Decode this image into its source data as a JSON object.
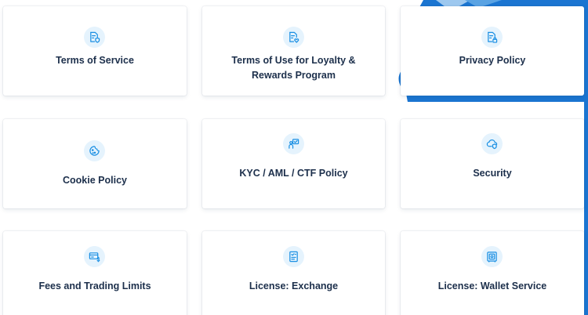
{
  "colors": {
    "accent": "#1a8fe3",
    "brand_blue": "#1b75d1",
    "icon_bg": "#e5f3fd",
    "text": "#1c2f4b"
  },
  "cards": [
    {
      "label": "Terms of Service",
      "icon": "document-shield-icon"
    },
    {
      "label": "Terms of Use for Loyalty & Rewards Program",
      "label_line1": "Terms of Use for Loyalty &",
      "label_line2": "Rewards Program",
      "icon": "document-heart-icon"
    },
    {
      "label": "Privacy Policy",
      "icon": "document-lock-icon"
    },
    {
      "label": "Cookie Policy",
      "icon": "cookie-icon"
    },
    {
      "label": "KYC / AML / CTF Policy",
      "icon": "id-verification-icon"
    },
    {
      "label": "Security",
      "icon": "cloud-shield-icon"
    },
    {
      "label": "Fees and Trading Limits",
      "icon": "card-dollar-icon"
    },
    {
      "label": "License: Exchange",
      "icon": "license-document-icon"
    },
    {
      "label": "License: Wallet Service",
      "icon": "wallet-vault-icon"
    }
  ]
}
